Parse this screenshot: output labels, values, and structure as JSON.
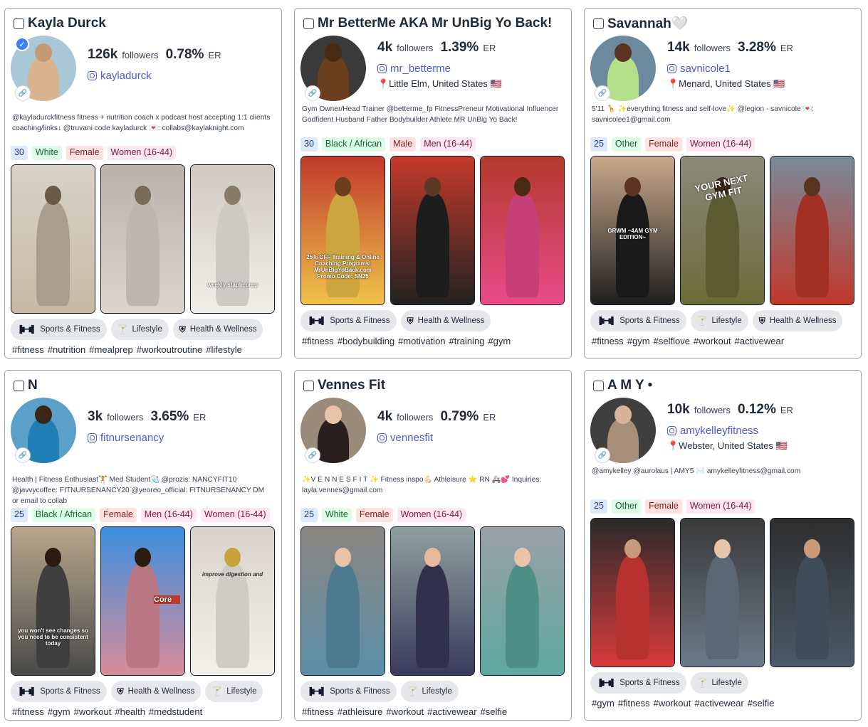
{
  "cards": [
    {
      "name": "Kayla Durck",
      "followers": "126k",
      "er": "0.78%",
      "handle": "kayladurck",
      "location": "",
      "bio": "@kayladurckfitness fitness + nutrition coach x podcast host accepting 1:1 clients coaching/links↓ @truvani code kayladurck 💌: collabs@kaylaknight.com",
      "tags": [
        {
          "text": "30",
          "cls": "t-age"
        },
        {
          "text": "White",
          "cls": "t-eth"
        },
        {
          "text": "Female",
          "cls": "t-gen"
        },
        {
          "text": "Women (16-44)",
          "cls": "t-aud"
        }
      ],
      "categories": [
        {
          "icon": "dumbbell-icon",
          "label": "Sports & Fitness"
        },
        {
          "icon": "cocktail-icon",
          "label": "Lifestyle"
        },
        {
          "icon": "shield-icon",
          "label": "Health & Wellness"
        }
      ],
      "hashtags": [
        "#fitness",
        "#nutrition",
        "#mealprep",
        "#workoutroutine",
        "#lifestyle"
      ],
      "verified": true,
      "captions": [
        "",
        "",
        "weekly staple prep"
      ]
    },
    {
      "name": "Mr BetterMe AKA Mr UnBig Yo Back!",
      "followers": "4k",
      "er": "1.39%",
      "handle": "mr_betterme",
      "location": "📍Little Elm, United States 🇺🇸",
      "bio": "Gym Owner/Head Trainer @betterme_fp FitnessPreneur Motivational Influencer Godfident Husband Father Bodybuilder Athlete MR UnBig Yo Back!",
      "tags": [
        {
          "text": "30",
          "cls": "t-age"
        },
        {
          "text": "Black / African",
          "cls": "t-eth"
        },
        {
          "text": "Male",
          "cls": "t-gen"
        },
        {
          "text": "Men (16-44)",
          "cls": "t-aud"
        }
      ],
      "categories": [
        {
          "icon": "dumbbell-icon",
          "label": "Sports & Fitness"
        },
        {
          "icon": "shield-icon",
          "label": "Health & Wellness"
        }
      ],
      "hashtags": [
        "#fitness",
        "#bodybuilding",
        "#motivation",
        "#training",
        "#gym"
      ],
      "verified": false,
      "captions": [
        "25% OFF Training & Online Coaching Programs! MrUnBigYoBack.com Promo Code: SN25",
        "",
        ""
      ]
    },
    {
      "name": "Savannah🤍",
      "followers": "14k",
      "er": "3.28%",
      "handle": "savnicole1",
      "location": "📍Menard, United States 🇺🇸",
      "bio": "5'11 🦒 ✨everything fitness and self-love✨ @legion - savnicole 💌: savnicolee1@gmail.com",
      "tags": [
        {
          "text": "25",
          "cls": "t-age"
        },
        {
          "text": "Other",
          "cls": "t-eth"
        },
        {
          "text": "Female",
          "cls": "t-gen"
        },
        {
          "text": "Women (16-44)",
          "cls": "t-aud"
        }
      ],
      "categories": [
        {
          "icon": "dumbbell-icon",
          "label": "Sports & Fitness"
        },
        {
          "icon": "cocktail-icon",
          "label": "Lifestyle"
        },
        {
          "icon": "shield-icon",
          "label": "Health & Wellness"
        }
      ],
      "hashtags": [
        "#fitness",
        "#gym",
        "#selflove",
        "#workout",
        "#activewear"
      ],
      "verified": false,
      "captions": [
        "GRWM ~4AM GYM EDITION~",
        "YOUR NEXT GYM FIT",
        ""
      ]
    },
    {
      "name": "N",
      "followers": "3k",
      "er": "3.65%",
      "handle": "fitnursenancy",
      "location": "",
      "bio": "Health | Fitness Enthusiast🏋️ Med Student🩺 @prozis: NANCYFIT10 @javvycoffee: FITNURSENANCY20 @yeoreo_official: FITNURSENANCY DM or email to collab",
      "tags": [
        {
          "text": "25",
          "cls": "t-age"
        },
        {
          "text": "Black / African",
          "cls": "t-eth"
        },
        {
          "text": "Female",
          "cls": "t-gen"
        },
        {
          "text": "Men (16-44)",
          "cls": "t-aud"
        },
        {
          "text": "Women (16-44)",
          "cls": "t-aud"
        }
      ],
      "categories": [
        {
          "icon": "dumbbell-icon",
          "label": "Sports & Fitness"
        },
        {
          "icon": "shield-icon",
          "label": "Health & Wellness"
        },
        {
          "icon": "cocktail-icon",
          "label": "Lifestyle"
        }
      ],
      "hashtags": [
        "#fitness",
        "#gym",
        "#workout",
        "#health",
        "#medstudent"
      ],
      "verified": false,
      "captions": [
        "you won't see changes so you need to be consistent today",
        "Core",
        "improve digestion and"
      ]
    },
    {
      "name": "Vennes Fit",
      "followers": "4k",
      "er": "0.79%",
      "handle": "vennesfit",
      "location": "",
      "bio": "✨V E N N E S F I T ✨ Fitness inspo💪🏻 Athleisure ⭐ RN 🚑💕 Inquiries: layla.vennes@gmail.com",
      "tags": [
        {
          "text": "25",
          "cls": "t-age"
        },
        {
          "text": "White",
          "cls": "t-eth"
        },
        {
          "text": "Female",
          "cls": "t-gen"
        },
        {
          "text": "Women (16-44)",
          "cls": "t-aud"
        }
      ],
      "categories": [
        {
          "icon": "dumbbell-icon",
          "label": "Sports & Fitness"
        },
        {
          "icon": "cocktail-icon",
          "label": "Lifestyle"
        }
      ],
      "hashtags": [
        "#fitness",
        "#athleisure",
        "#workout",
        "#activewear",
        "#selfie"
      ],
      "verified": false,
      "captions": [
        "",
        "",
        ""
      ]
    },
    {
      "name": "A M Y •",
      "followers": "10k",
      "er": "0.12%",
      "handle": "amykelleyfitness",
      "location": "📍Webster, United States 🇺🇸",
      "bio": "@amykelley @aurolaus | AMY5 ✉️ amykelleyfitness@gmail.com",
      "tags": [
        {
          "text": "25",
          "cls": "t-age"
        },
        {
          "text": "Other",
          "cls": "t-eth"
        },
        {
          "text": "Female",
          "cls": "t-gen"
        },
        {
          "text": "Women (16-44)",
          "cls": "t-aud"
        }
      ],
      "categories": [
        {
          "icon": "dumbbell-icon",
          "label": "Sports & Fitness"
        },
        {
          "icon": "cocktail-icon",
          "label": "Lifestyle"
        }
      ],
      "hashtags": [
        "#gym",
        "#fitness",
        "#workout",
        "#activewear",
        "#selfie"
      ],
      "verified": false,
      "captions": [
        "",
        "",
        ""
      ]
    }
  ],
  "labels": {
    "followers": "followers",
    "er": "ER"
  },
  "colors": {
    "link": "#4f5bd5",
    "chip": "#e5e7eb",
    "border": "#9ca3af"
  }
}
